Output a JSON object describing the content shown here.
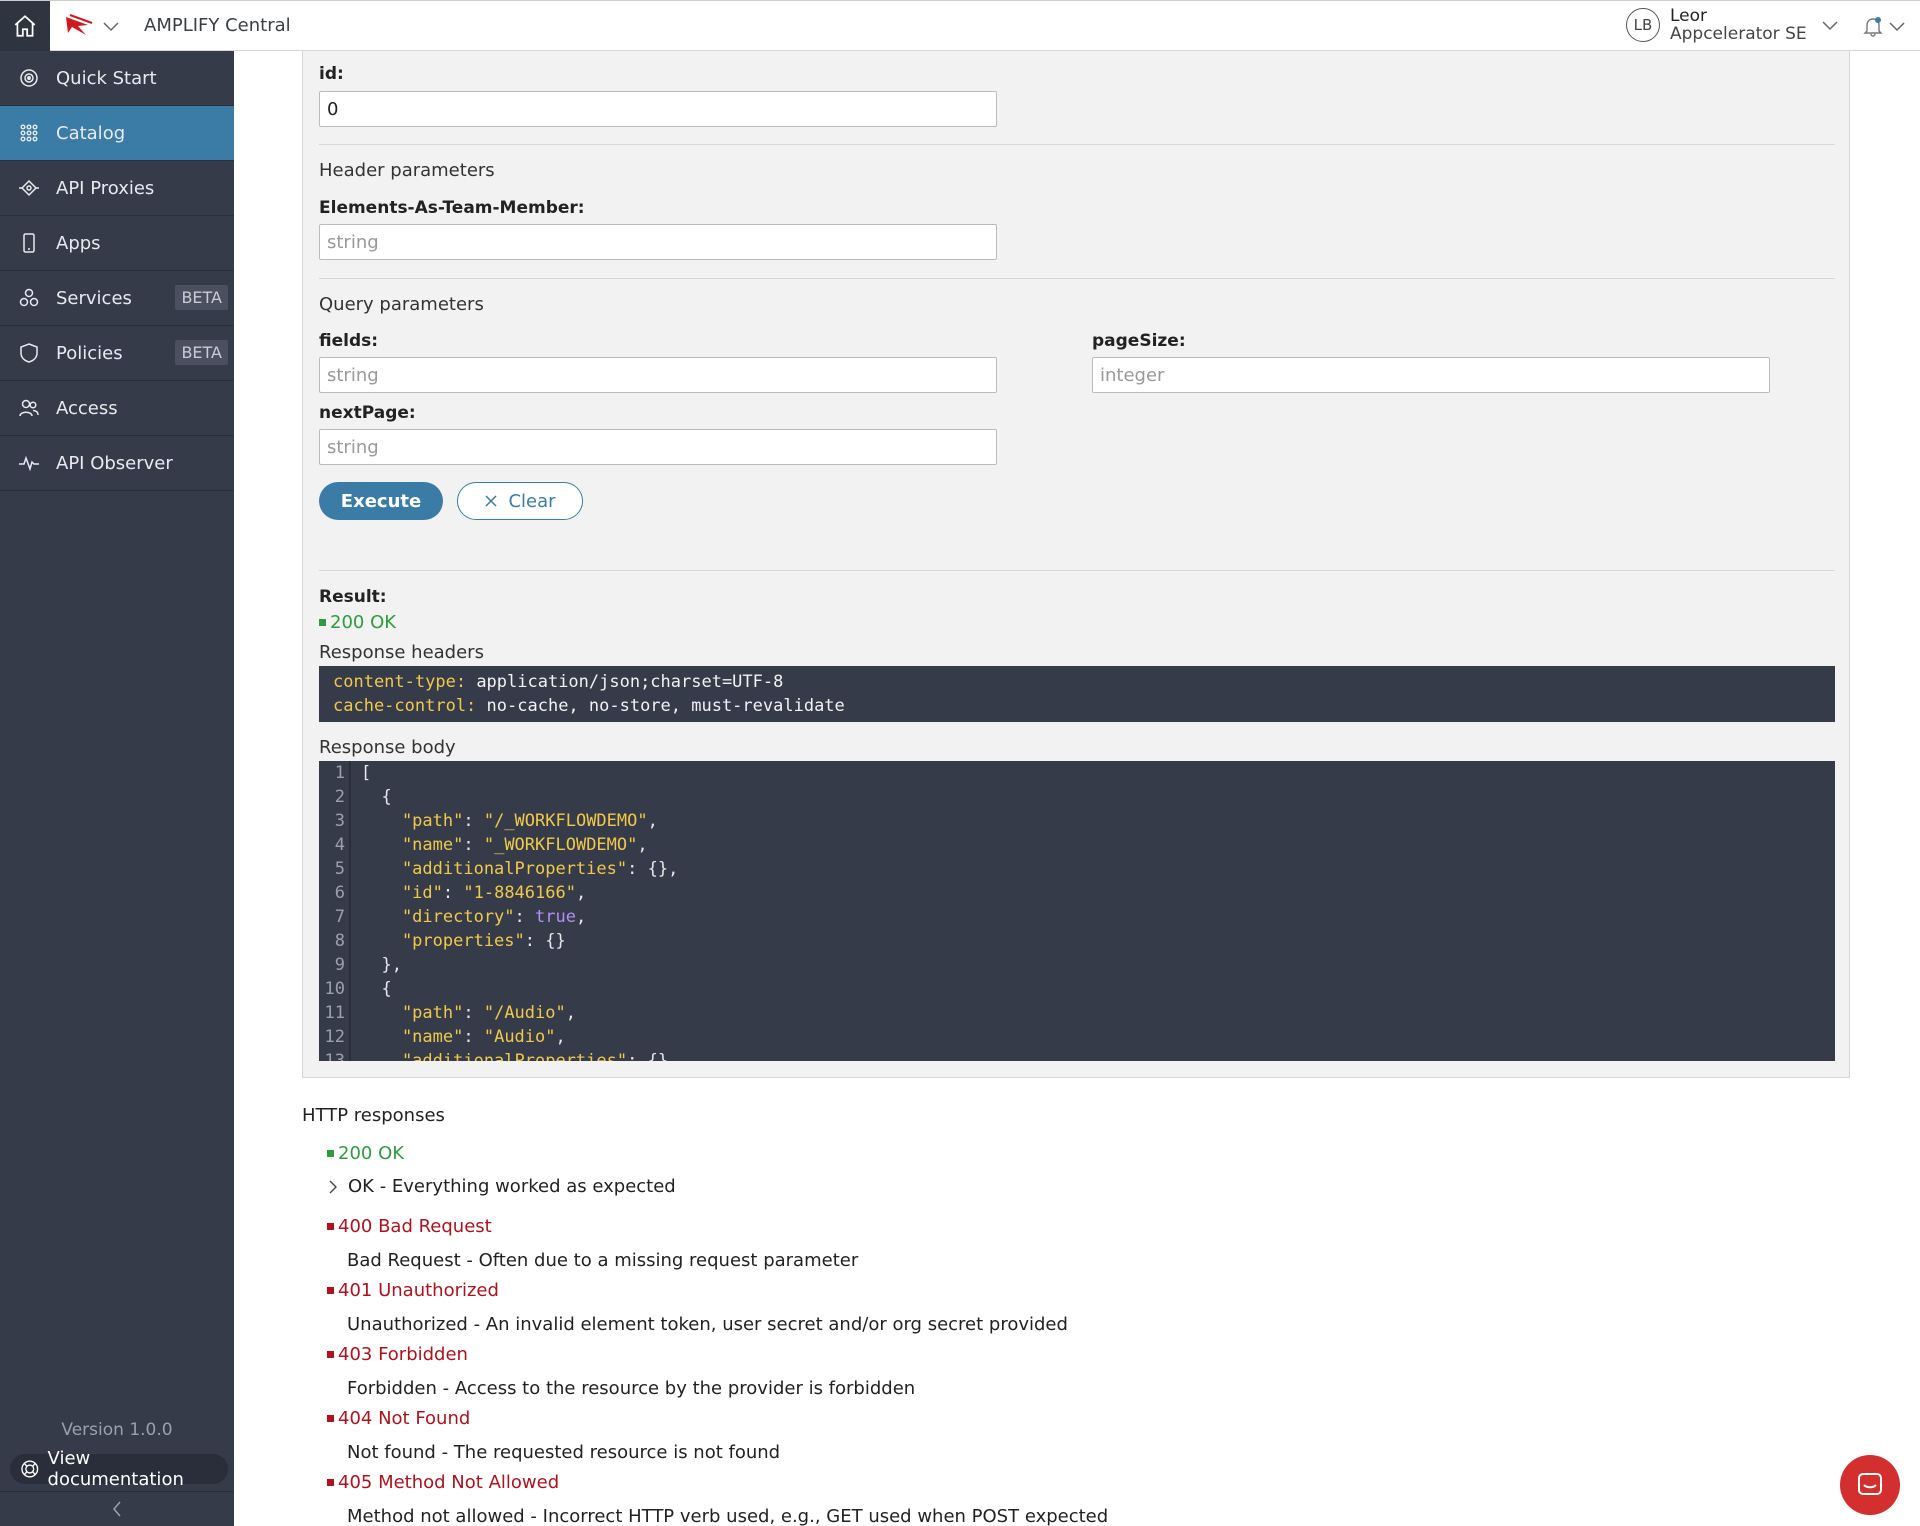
{
  "header": {
    "app_title": "AMPLIFY Central",
    "user": {
      "initials": "LB",
      "name": "Leor",
      "org": "Appcelerator SE"
    }
  },
  "sidebar": {
    "items": [
      {
        "label": "Quick Start",
        "icon": "quick-start-icon"
      },
      {
        "label": "Catalog",
        "icon": "grid-icon",
        "active": true
      },
      {
        "label": "API Proxies",
        "icon": "api-proxies-icon"
      },
      {
        "label": "Apps",
        "icon": "phone-icon"
      },
      {
        "label": "Services",
        "icon": "services-icon",
        "badge": "BETA"
      },
      {
        "label": "Policies",
        "icon": "shield-icon",
        "badge": "BETA"
      },
      {
        "label": "Access",
        "icon": "users-icon"
      },
      {
        "label": "API Observer",
        "icon": "pulse-icon"
      }
    ],
    "version": "Version 1.0.0",
    "view_doc": "View documentation"
  },
  "form": {
    "id_label": "id:",
    "id_value": "0",
    "header_params_title": "Header parameters",
    "elements_label": "Elements-As-Team-Member:",
    "elements_placeholder": "string",
    "query_params_title": "Query parameters",
    "fields_label": "fields:",
    "fields_placeholder": "string",
    "pagesize_label": "pageSize:",
    "pagesize_placeholder": "integer",
    "nextpage_label": "nextPage:",
    "nextpage_placeholder": "string",
    "execute_label": "Execute",
    "clear_label": "Clear"
  },
  "result": {
    "label": "Result:",
    "status": "200 OK",
    "response_headers_title": "Response headers",
    "headers": [
      {
        "key": "content-type:",
        "value": "application/json;charset=UTF-8"
      },
      {
        "key": "cache-control:",
        "value": "no-cache, no-store, must-revalidate"
      }
    ],
    "response_body_title": "Response body",
    "body_lines": [
      {
        "n": "1",
        "t": "["
      },
      {
        "n": "2",
        "t": "  {"
      },
      {
        "n": "3",
        "k": "    \"path\"",
        "s": "\"/_WORKFLOWDEMO\"",
        "end": ","
      },
      {
        "n": "4",
        "k": "    \"name\"",
        "s": "\"_WORKFLOWDEMO\"",
        "end": ","
      },
      {
        "n": "5",
        "k": "    \"additionalProperties\"",
        "p": "{}",
        "end": ","
      },
      {
        "n": "6",
        "k": "    \"id\"",
        "s": "\"1-8846166\"",
        "end": ","
      },
      {
        "n": "7",
        "k": "    \"directory\"",
        "b": "true",
        "end": ","
      },
      {
        "n": "8",
        "k": "    \"properties\"",
        "p": "{}",
        "end": ""
      },
      {
        "n": "9",
        "t": "  },"
      },
      {
        "n": "10",
        "t": "  {"
      },
      {
        "n": "11",
        "k": "    \"path\"",
        "s": "\"/Audio\"",
        "end": ","
      },
      {
        "n": "12",
        "k": "    \"name\"",
        "s": "\"Audio\"",
        "end": ","
      },
      {
        "n": "13",
        "k": "    \"additionalProperties\"",
        "p": "{}",
        "end": ","
      }
    ]
  },
  "http_responses": {
    "title": "HTTP responses",
    "items": [
      {
        "code": "200 OK",
        "desc": "OK - Everything worked as expected",
        "ok": true
      },
      {
        "code": "400 Bad Request",
        "desc": "Bad Request - Often due to a missing request parameter"
      },
      {
        "code": "401 Unauthorized",
        "desc": "Unauthorized - An invalid element token, user secret and/or org secret provided"
      },
      {
        "code": "403 Forbidden",
        "desc": "Forbidden - Access to the resource by the provider is forbidden"
      },
      {
        "code": "404 Not Found",
        "desc": "Not found - The requested resource is not found"
      },
      {
        "code": "405 Method Not Allowed",
        "desc": "Method not allowed - Incorrect HTTP verb used, e.g., GET used when POST expected"
      }
    ]
  },
  "colors": {
    "sidebar_bg": "#363b49",
    "accent": "#3a7ca5",
    "ok": "#2e9c3e",
    "error": "#b0121c",
    "code_key": "#f0c94a",
    "code_bool": "#b48ef2"
  }
}
